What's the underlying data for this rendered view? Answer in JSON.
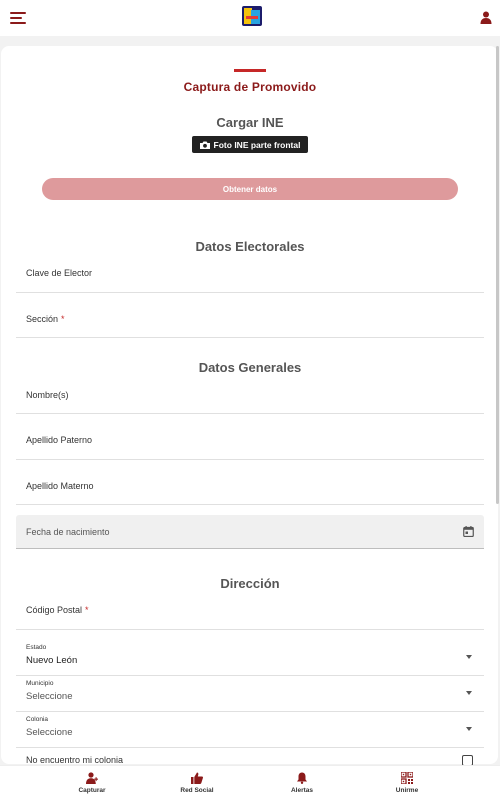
{
  "header": {
    "menu_icon": "hamburger-icon",
    "logo": "app-logo",
    "user_icon": "user-icon"
  },
  "page": {
    "title": "Captura de Promovido"
  },
  "ine": {
    "title": "Cargar INE",
    "photo_button": "Foto INE parte frontal",
    "photo_icon": "camera-icon",
    "obtain_button": "Obtener datos"
  },
  "electoral": {
    "title": "Datos Electorales",
    "clave_label": "Clave de Elector",
    "seccion_label": "Sección",
    "required_mark": "*"
  },
  "general": {
    "title": "Datos Generales",
    "nombre_label": "Nombre(s)",
    "paterno_label": "Apellido Paterno",
    "materno_label": "Apellido Materno",
    "fecha_label": "Fecha de nacimiento"
  },
  "direccion": {
    "title": "Dirección",
    "cp_label": "Código Postal",
    "required_mark": "*",
    "estado_label": "Estado",
    "estado_value": "Nuevo León",
    "municipio_label": "Municipio",
    "municipio_value": "Seleccione",
    "colonia_label": "Colonia",
    "colonia_value": "Seleccione",
    "no_colonia_label": "No encuentro mi colonia"
  },
  "bottom_nav": {
    "items": [
      {
        "label": "Capturar",
        "icon": "add-user-icon"
      },
      {
        "label": "Red Social",
        "icon": "thumbs-up-icon"
      },
      {
        "label": "Alertas",
        "icon": "bell-icon"
      },
      {
        "label": "Unirme",
        "icon": "qr-code-icon"
      }
    ]
  },
  "colors": {
    "brand": "#8b1a1a",
    "accent": "#c62828",
    "button_disabled": "#de9a9c"
  }
}
